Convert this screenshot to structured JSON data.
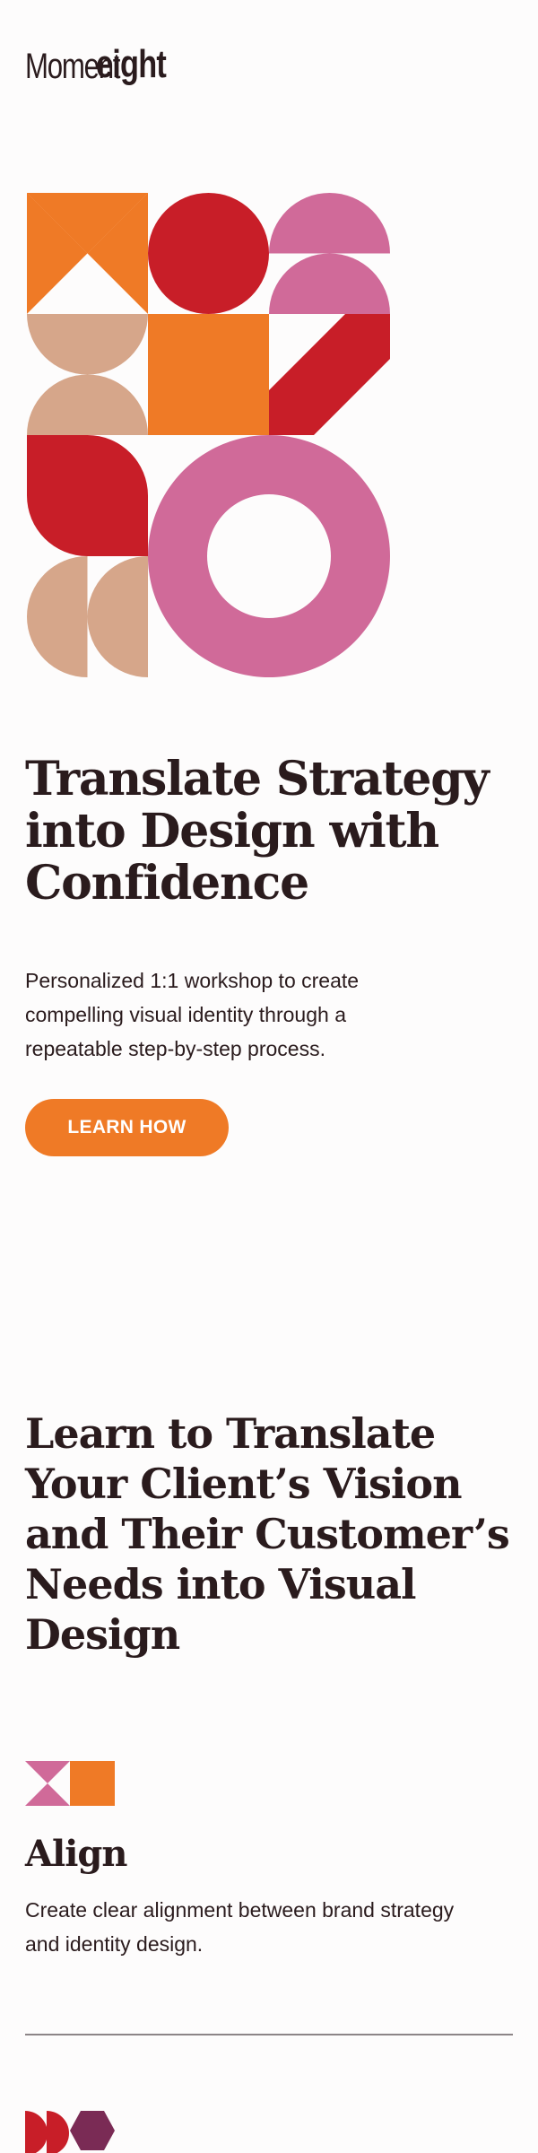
{
  "brand": {
    "logo_light": "Moment",
    "logo_bold": "eight"
  },
  "colors": {
    "orange": "#ef7a26",
    "red": "#c81e28",
    "pink": "#d06a99",
    "tan": "#d6a68a",
    "plum": "#7a2b55",
    "text": "#2a1b1d"
  },
  "hero": {
    "title": "Translate Strategy into Design with Confidence",
    "subtitle": "Personalized 1:1 workshop to create compelling visual identity through a repeatable step-by-step process.",
    "cta_label": "LEARN HOW"
  },
  "section": {
    "title": "Learn to Translate Your Client’s Vision and Their Customer’s Needs into Visual Design"
  },
  "feature": {
    "title": "Align",
    "description": "Create clear alignment between brand strategy and identity design."
  }
}
